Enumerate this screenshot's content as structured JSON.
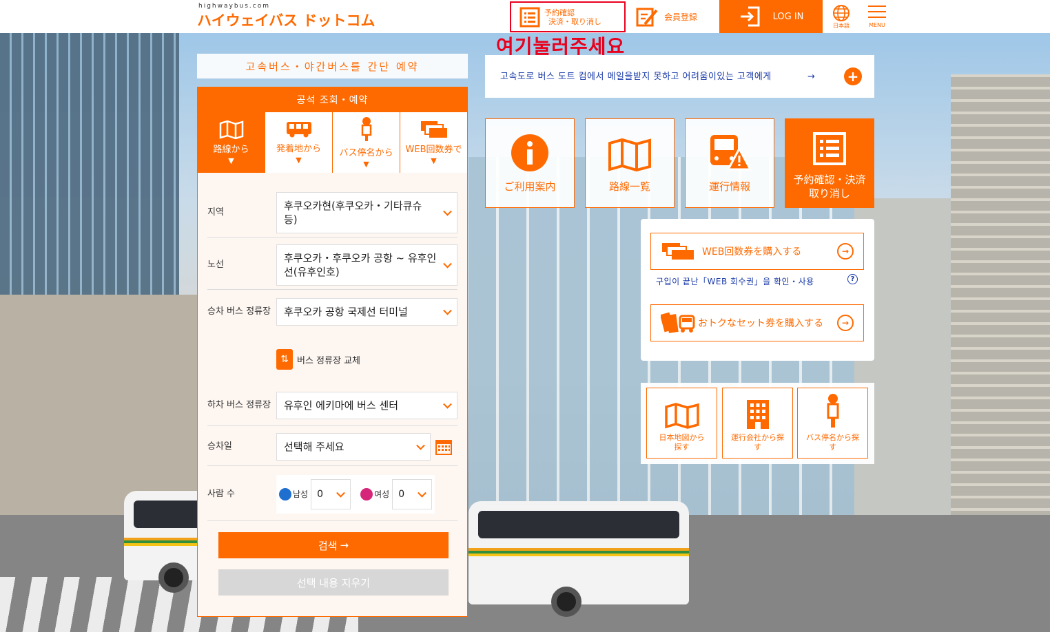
{
  "header": {
    "logo_small": "highwaybus.com",
    "logo": "ハイウェイバス ドットコム",
    "confirm_line1": "予約確認",
    "confirm_line2": "決済・取り消し",
    "member": "会員登録",
    "login": "LOG IN",
    "lang": "日本語",
    "menu": "MENU"
  },
  "annotation": "여기눌러주세요",
  "booking": {
    "quick_title": "고속버스・야간버스를 간단 예약",
    "panel_title": "공석 조회・예약",
    "tabs": [
      {
        "label": "路線から",
        "icon": "map-icon",
        "active": true
      },
      {
        "label": "発着地から",
        "icon": "bus-icon",
        "active": false
      },
      {
        "label": "バス停名から",
        "icon": "bus-stop-icon",
        "active": false
      },
      {
        "label": "WEB回数券で",
        "icon": "ticket-icon",
        "active": false
      }
    ],
    "region_label": "지역",
    "region_value": "후쿠오카현(후쿠오카・기타큐슈 등)",
    "route_label": "노선",
    "route_value": "후쿠오카・후쿠오카 공항 ~ 유후인선(유후인호)",
    "board_label": "승차 버스 정류장",
    "board_value": "후쿠오카 공항 국제선 터미널",
    "swap_label": "버스 정류장 교체",
    "alight_label": "하차 버스 정류장",
    "alight_value": "유후인 에키마에 버스 센터",
    "date_label": "승차일",
    "date_value": "선택해 주세요",
    "people_label": "사람 수",
    "male_label": "남성",
    "male_value": "0",
    "female_label": "여성",
    "female_value": "0",
    "search_button": "검색",
    "clear_button": "선택 내용 지우기"
  },
  "notice": {
    "text": "고속도로 버스 도트 컴에서 메일을받지 못하고 어려움이있는 고객에게",
    "arrow": "→",
    "plus": "+"
  },
  "tiles": [
    {
      "label": "ご利用案内"
    },
    {
      "label": "路線一覧"
    },
    {
      "label": "運行情報"
    },
    {
      "label": "予約確認・決済取り消し"
    }
  ],
  "web": {
    "buy_coupon": "WEB回数券を購入する",
    "check_link": "구입이 끝난「WEB 회수권」을 확인・사용",
    "buy_set": "おトクなセット券を購入する"
  },
  "search_tiles": [
    {
      "label": "日本地図から探す"
    },
    {
      "label": "運行会社から探す"
    },
    {
      "label": "バス停名から探す"
    }
  ],
  "colors": {
    "accent": "#ff6a00",
    "annotation": "#e8001d",
    "link": "#1a3aa8"
  }
}
